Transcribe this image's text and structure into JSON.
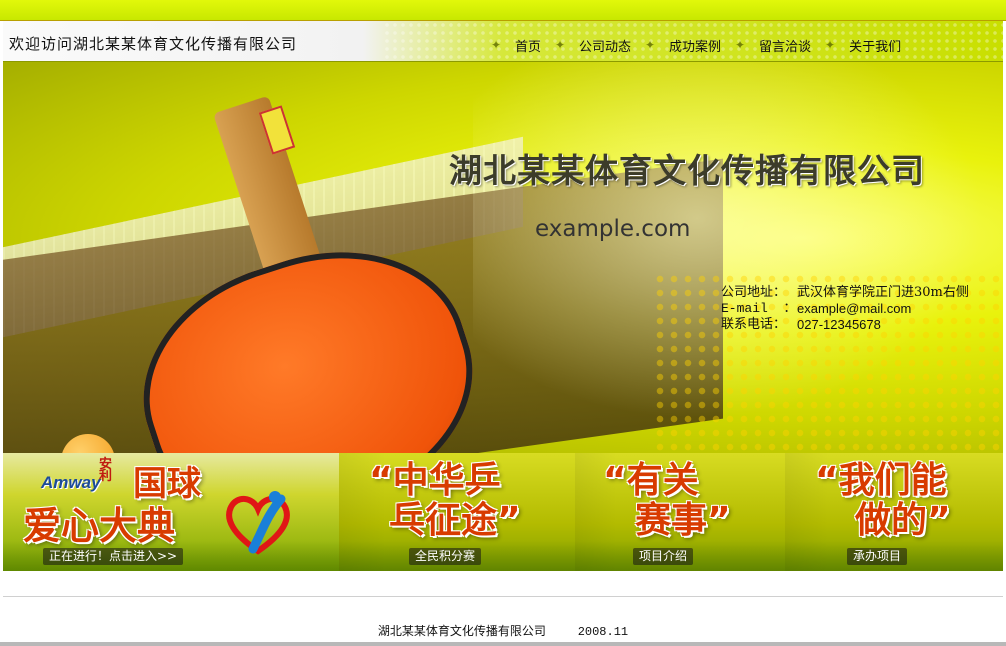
{
  "header": {
    "welcome": "欢迎访问湖北某某体育文化传播有限公司",
    "nav": [
      "首页",
      "公司动态",
      "成功案例",
      "留言洽谈",
      "关于我们"
    ]
  },
  "hero": {
    "company_name": "湖北某某体育文化传播有限公司",
    "domain": "example.com",
    "contact": {
      "address_label": "公司地址：",
      "address": "武汉体育学院正门进30m右侧",
      "email_label": "E-mail  ：",
      "email": "example@mail.com",
      "phone_label": "联系电话：",
      "phone": "027-12345678"
    }
  },
  "banners": [
    {
      "brand": "Amway",
      "brand_cn": "安利",
      "line1": "国球",
      "line2": "爱心大典",
      "caption": "正在进行！点击进入>>"
    },
    {
      "line1": "“中华乒",
      "line2": "乓征途”",
      "caption": "全民积分赛"
    },
    {
      "line1": "“有关",
      "line2": "赛事”",
      "caption": "项目介绍"
    },
    {
      "line1": "“我们能",
      "line2": "做的”",
      "caption": "承办项目"
    }
  ],
  "footer": {
    "company": "湖北某某体育文化传播有限公司",
    "date": "2008.11"
  }
}
